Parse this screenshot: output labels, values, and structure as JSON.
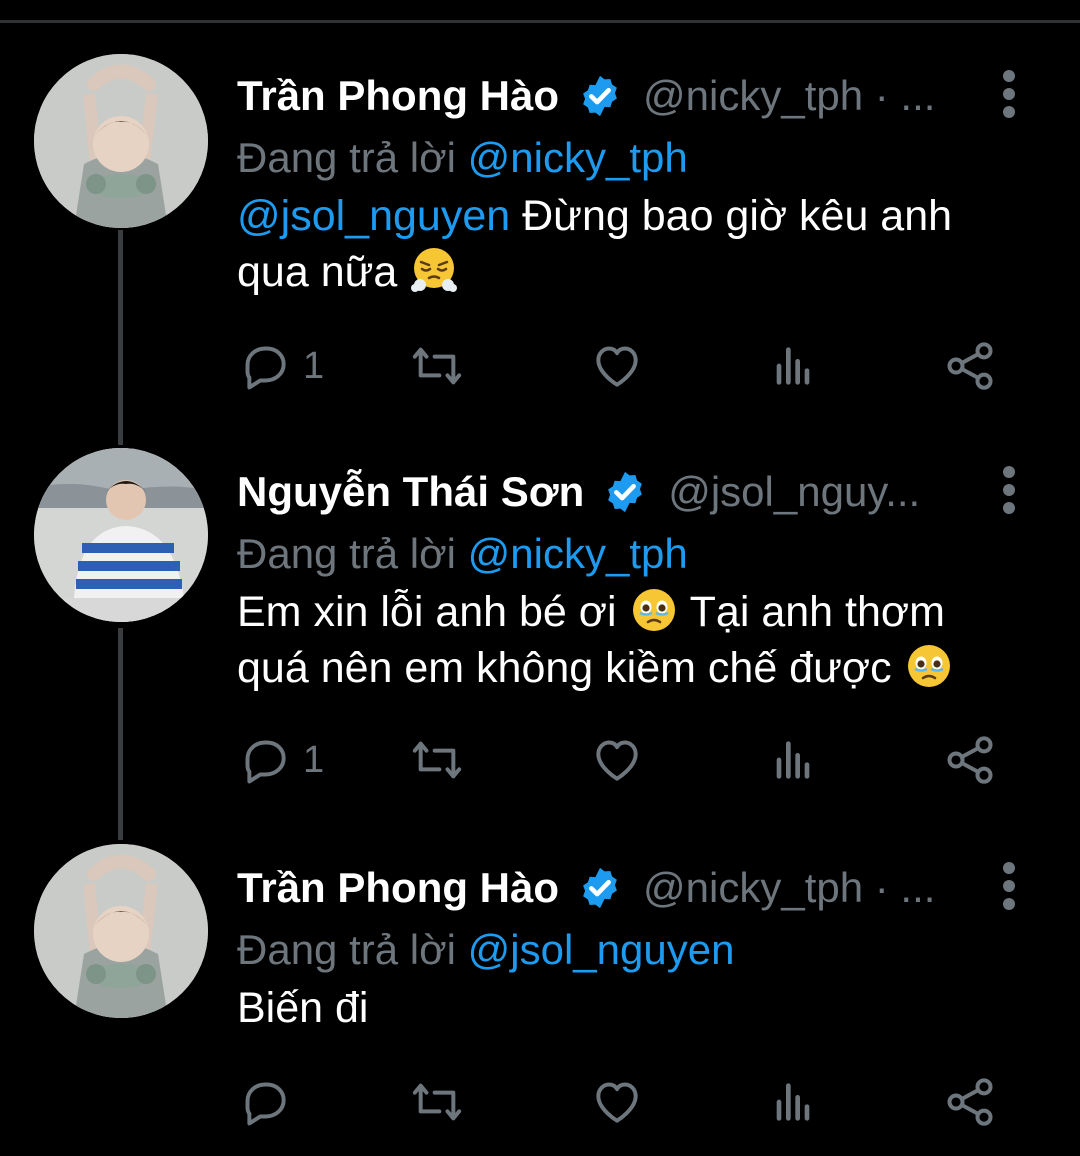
{
  "colors": {
    "background": "#000000",
    "name": "#ffffff",
    "muted": "#6e767d",
    "link": "#1d9bf0",
    "verified": "#1d9bf0"
  },
  "icons": [
    "more-vertical-icon",
    "verified-badge-icon",
    "reply-icon",
    "retweet-icon",
    "like-icon",
    "analytics-icon",
    "share-icon"
  ],
  "tweets": [
    {
      "name": "Trần Phong Hào",
      "handle": "@nicky_tph · ...",
      "reply_prefix": "Đang trả lời",
      "reply_to": "@nicky_tph",
      "mention": "@jsol_nguyen",
      "text_line1": " Đừng bao giờ kêu anh",
      "text_line2": "qua nữa ",
      "reply_count": "1"
    },
    {
      "name": "Nguyễn Thái Sơn",
      "handle": "@jsol_nguy...",
      "reply_prefix": "Đang trả lời",
      "reply_to": "@nicky_tph",
      "text_line1": "Em xin lỗi anh bé ơi ",
      "text_line1b": " Tại anh thơm",
      "text_line2": "quá nên em không kiềm chế được ",
      "reply_count": "1"
    },
    {
      "name": "Trần Phong Hào",
      "handle": "@nicky_tph · ...",
      "reply_prefix": "Đang trả lời",
      "reply_to": "@jsol_nguyen",
      "text_line1": "Biến đi",
      "reply_count": ""
    }
  ]
}
